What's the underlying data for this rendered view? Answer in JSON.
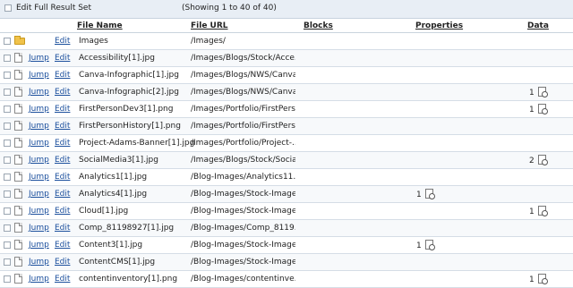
{
  "toolbar": {
    "edit_full_label": "Edit Full Result Set",
    "showing": "(Showing 1 to 40 of 40)"
  },
  "columns": {
    "file_name": "File Name",
    "file_url": "File URL",
    "blocks": "Blocks",
    "properties": "Properties",
    "data": "Data"
  },
  "rows": [
    {
      "type": "folder",
      "jump": "",
      "edit": "Edit",
      "name": "Images",
      "url": "/Images/",
      "prop": "",
      "data": ""
    },
    {
      "type": "file",
      "jump": "Jump",
      "edit": "Edit",
      "name": "Accessibility[1].jpg",
      "url": "/Images/Blogs/Stock/Acce...",
      "prop": "",
      "data": ""
    },
    {
      "type": "file",
      "jump": "Jump",
      "edit": "Edit",
      "name": "Canva-Infographic[1].jpg",
      "url": "/Images/Blogs/NWS/Canva...",
      "prop": "",
      "data": ""
    },
    {
      "type": "file",
      "jump": "Jump",
      "edit": "Edit",
      "name": "Canva-Infographic[2].jpg",
      "url": "/Images/Blogs/NWS/Canva...",
      "prop": "",
      "data": "1"
    },
    {
      "type": "file",
      "jump": "Jump",
      "edit": "Edit",
      "name": "FirstPersonDev3[1].png",
      "url": "/Images/Portfolio/FirstPers...",
      "prop": "",
      "data": "1"
    },
    {
      "type": "file",
      "jump": "Jump",
      "edit": "Edit",
      "name": "FirstPersonHistory[1].png",
      "url": "/Images/Portfolio/FirstPers...",
      "prop": "",
      "data": ""
    },
    {
      "type": "file",
      "jump": "Jump",
      "edit": "Edit",
      "name": "Project-Adams-Banner[1].jpg",
      "url": "/Images/Portfolio/Project-...",
      "prop": "",
      "data": ""
    },
    {
      "type": "file",
      "jump": "Jump",
      "edit": "Edit",
      "name": "SocialMedia3[1].jpg",
      "url": "/Images/Blogs/Stock/Socia...",
      "prop": "",
      "data": "2"
    },
    {
      "type": "file",
      "jump": "Jump",
      "edit": "Edit",
      "name": "Analytics1[1].jpg",
      "url": "/Blog-Images/Analytics11...",
      "prop": "",
      "data": ""
    },
    {
      "type": "file",
      "jump": "Jump",
      "edit": "Edit",
      "name": "Analytics4[1].jpg",
      "url": "/Blog-Images/Stock-Image...",
      "prop": "1",
      "data": ""
    },
    {
      "type": "file",
      "jump": "Jump",
      "edit": "Edit",
      "name": "Cloud[1].jpg",
      "url": "/Blog-Images/Stock-Image...",
      "prop": "",
      "data": "1"
    },
    {
      "type": "file",
      "jump": "Jump",
      "edit": "Edit",
      "name": "Comp_81198927[1].jpg",
      "url": "/Blog-Images/Comp_8119...",
      "prop": "",
      "data": ""
    },
    {
      "type": "file",
      "jump": "Jump",
      "edit": "Edit",
      "name": "Content3[1].jpg",
      "url": "/Blog-Images/Stock-Image...",
      "prop": "1",
      "data": ""
    },
    {
      "type": "file",
      "jump": "Jump",
      "edit": "Edit",
      "name": "ContentCMS[1].jpg",
      "url": "/Blog-Images/Stock-Image...",
      "prop": "",
      "data": ""
    },
    {
      "type": "file",
      "jump": "Jump",
      "edit": "Edit",
      "name": "contentinventory[1].png",
      "url": "/Blog-Images/contentinve...",
      "prop": "",
      "data": "1"
    }
  ]
}
